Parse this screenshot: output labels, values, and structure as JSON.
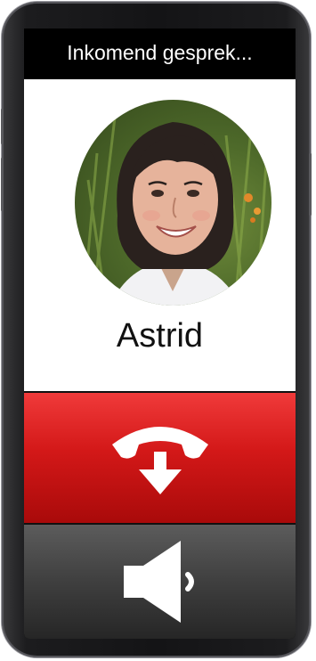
{
  "call": {
    "status_text": "Inkomend gesprek...",
    "caller_name": "Astrid"
  },
  "icons": {
    "reject": "hang-up-phone-with-down-arrow-icon",
    "speaker": "speaker-icon"
  },
  "colors": {
    "header_bg": "#000000",
    "reject_bg": "#d31818",
    "speaker_bg": "#3f3f3f",
    "name_text": "#111111",
    "icon_fg": "#ffffff"
  }
}
